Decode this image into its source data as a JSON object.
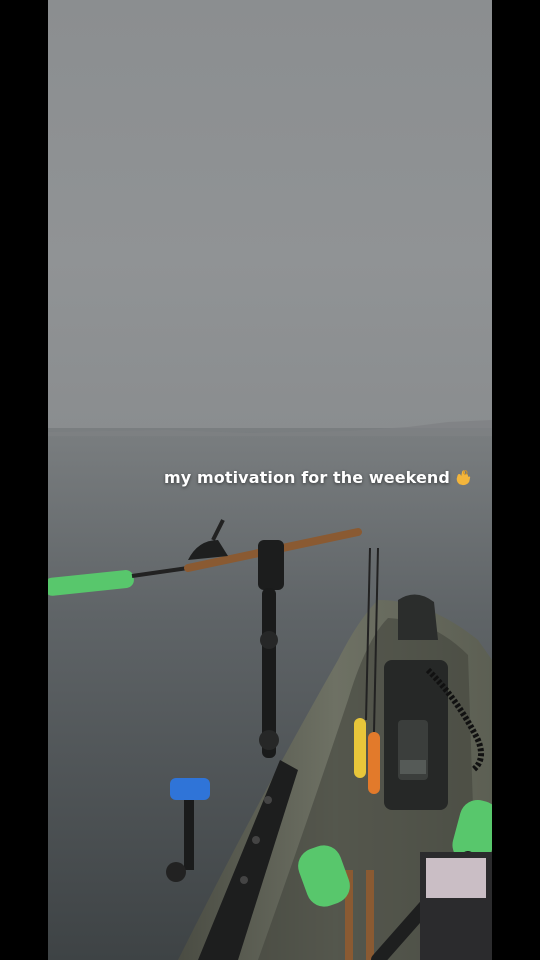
{
  "video": {
    "caption": "my motivation for the weekend",
    "caption_emoji": "hand-ok-emoji",
    "sky_color": "#8e9194",
    "water_color": "#5d6265",
    "kayak_color": "#6b6e5e",
    "foam_grip_color": "#58c76c",
    "float_yellow": "#e8c63a",
    "float_orange": "#e27a2b",
    "camera_mount_color": "#2f74d8"
  }
}
